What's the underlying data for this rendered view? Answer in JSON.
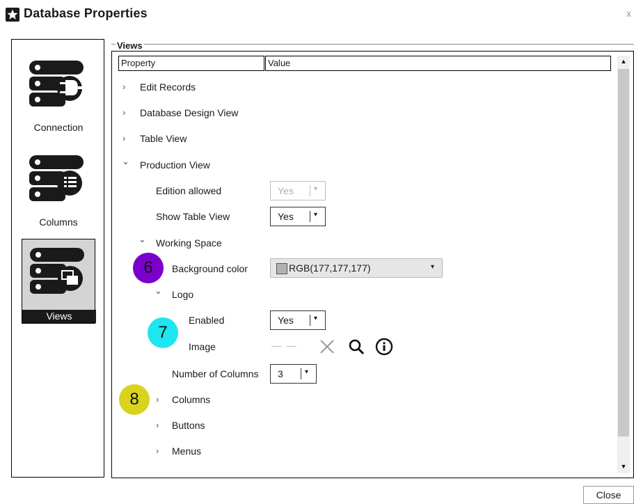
{
  "window": {
    "title": "Database Properties",
    "close_glyph": "x"
  },
  "nav": [
    {
      "label": "Connection",
      "icon": "database-plug-icon",
      "selected": false
    },
    {
      "label": "Columns",
      "icon": "database-columns-icon",
      "selected": false
    },
    {
      "label": "Views",
      "icon": "database-views-icon",
      "selected": true
    }
  ],
  "group": {
    "title": "Views"
  },
  "table": {
    "header_property": "Property",
    "header_value": "Value"
  },
  "tree": {
    "edit_records": "Edit Records",
    "database_design_view": "Database Design View",
    "table_view": "Table View",
    "production_view": "Production View",
    "edition_allowed": {
      "label": "Edition allowed",
      "value": "Yes",
      "disabled": true
    },
    "show_table_view": {
      "label": "Show Table View",
      "value": "Yes"
    },
    "working_space": "Working Space",
    "background_color": {
      "label": "Background color",
      "value": "RGB(177,177,177)",
      "swatch": "#b1b1b1"
    },
    "logo": "Logo",
    "enabled": {
      "label": "Enabled",
      "value": "Yes"
    },
    "image": {
      "label": "Image",
      "placeholder": "— —"
    },
    "number_of_columns": {
      "label": "Number of Columns",
      "value": "3"
    },
    "columns": "Columns",
    "buttons": "Buttons",
    "menus": "Menus"
  },
  "badges": [
    {
      "num": "6",
      "color": "#7b00cc"
    },
    {
      "num": "7",
      "color": "#1ee6f0"
    },
    {
      "num": "8",
      "color": "#d9d320"
    }
  ],
  "footer": {
    "close_label": "Close"
  },
  "glyphs": {
    "chev_right": "›",
    "chev_down": "⌄",
    "dropdown": "▾"
  }
}
